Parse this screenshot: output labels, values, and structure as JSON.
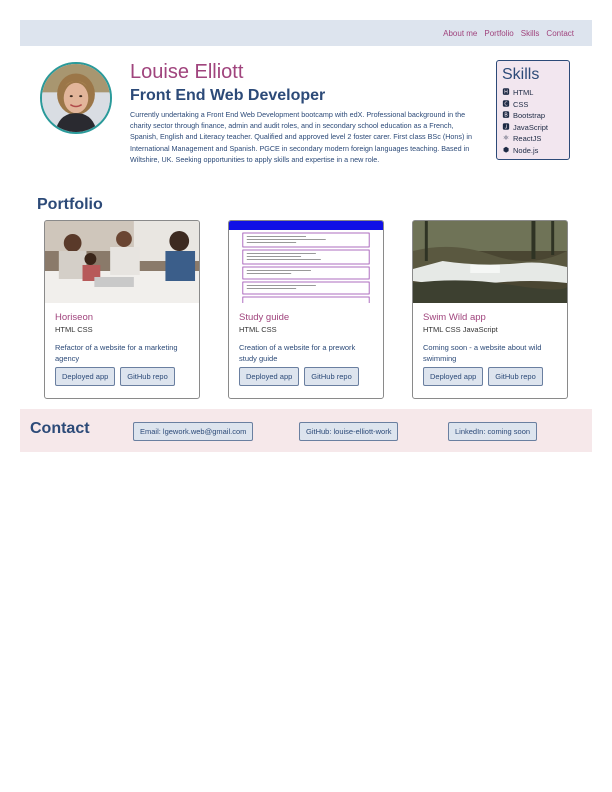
{
  "nav": {
    "links": [
      "About me",
      "Portfolio",
      "Skills",
      "Contact"
    ]
  },
  "profile": {
    "name": "Louise Elliott",
    "role": "Front End Web Developer",
    "bio": "Currently undertaking a Front End Web Development bootcamp with edX. Professional background in the charity sector through finance, admin and audit roles, and in secondary school education as a French, Spanish, English and Literacy teacher. Qualified and approved level 2 foster carer. First class BSc (Hons) in International Management and Spanish. PGCE in secondary modern foreign languages teaching. Based in Wiltshire, UK. Seeking opportunities to apply skills and expertise in a new role."
  },
  "skills": {
    "title": "Skills",
    "items": [
      {
        "label": "HTML",
        "icon": "html5-icon"
      },
      {
        "label": "CSS",
        "icon": "css3-icon"
      },
      {
        "label": "Bootstrap",
        "icon": "bootstrap-icon"
      },
      {
        "label": "JavaScript",
        "icon": "javascript-icon"
      },
      {
        "label": "ReactJS",
        "icon": "react-icon"
      },
      {
        "label": "Node.js",
        "icon": "nodejs-icon"
      }
    ]
  },
  "portfolio": {
    "title": "Portfolio",
    "projects": [
      {
        "title": "Horiseon",
        "tech": "HTML CSS",
        "desc": "Refactor of a website for a marketing agency",
        "deployed_label": "Deployed app",
        "repo_label": "GitHub repo"
      },
      {
        "title": "Study guide",
        "tech": "HTML CSS",
        "desc": "Creation of a website for a prework study guide",
        "deployed_label": "Deployed app",
        "repo_label": "GitHub repo"
      },
      {
        "title": "Swim Wild app",
        "tech": "HTML CSS JavaScript",
        "desc": "Coming soon - a website about wild swimming",
        "deployed_label": "Deployed app",
        "repo_label": "GitHub repo"
      }
    ]
  },
  "contact": {
    "title": "Contact",
    "email": "Email: lgework.web@gmail.com",
    "github": "GitHub: louise-elliott-work",
    "linkedin": "LinkedIn: coming soon"
  },
  "colors": {
    "accent": "#a0447d",
    "primary": "#2c4a78",
    "nav_bg": "#dde4ee",
    "contact_bg": "#f6e8ea",
    "skills_bg": "#f2e6ef"
  }
}
